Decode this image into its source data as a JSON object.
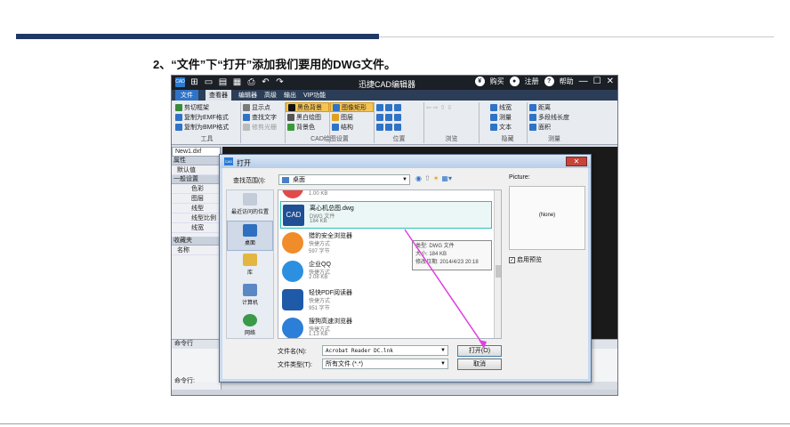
{
  "slide": {
    "heading": "2、“文件”下“打开”添加我们要用的DWG文件。"
  },
  "app": {
    "title": "迅捷CAD编辑器",
    "logo_text": "CAD",
    "top_right": {
      "buy": "购买",
      "register": "注册",
      "help": "帮助"
    },
    "window_controls": {
      "minimize": "—",
      "maximize": "☐",
      "close": "✕"
    },
    "menu_tabs": [
      "文件",
      "查看器",
      "编辑器",
      "高级",
      "输出",
      "VIP功能"
    ],
    "ribbon": {
      "groups": [
        {
          "label": "工具",
          "buttons": [
            "剪切框架",
            "复制为EMF格式",
            "复制为BMP格式"
          ]
        },
        {
          "label": "",
          "buttons": [
            "显示点",
            "查找文字",
            "修剪光栅"
          ]
        },
        {
          "label": "CAD绘图设置",
          "buttons": [
            "黑色背景",
            "黑白绘图",
            "背景色"
          ]
        },
        {
          "label": "",
          "buttons": [
            "图像矩形",
            "图层",
            "结构"
          ]
        },
        {
          "label": "位置",
          "buttons": []
        },
        {
          "label": "浏览",
          "buttons": []
        },
        {
          "label": "隐藏",
          "buttons": [
            "线宽",
            "测量",
            "文本"
          ]
        },
        {
          "label": "测量",
          "buttons": [
            "距离",
            "多段线长度",
            "面积"
          ]
        }
      ]
    },
    "left_panel": {
      "doc_tab": "New1.dxf",
      "props_header": "属性",
      "default_row": "默认值",
      "general_header": "一般设置",
      "rows": [
        "色彩",
        "图层",
        "线型",
        "线型比例",
        "线宽"
      ],
      "favorites_header": "收藏夹",
      "name_row": "名称"
    },
    "command": {
      "header": "命令行",
      "prompt": "命令行:"
    }
  },
  "dialog": {
    "title": "打开",
    "lookin_label": "查找范围(I):",
    "lookin_value": "桌面",
    "places": [
      "最近访问的位置",
      "桌面",
      "库",
      "计算机",
      "网络"
    ],
    "files": [
      {
        "name": "",
        "type": "",
        "size": "1.00 KB"
      },
      {
        "name": "离心机总图.dwg",
        "type": "DWG 文件",
        "size": "184 KB"
      },
      {
        "name": "猎豹安全浏览器",
        "type": "快捷方式",
        "size": "597 字节"
      },
      {
        "name": "企业QQ",
        "type": "快捷方式",
        "size": "2.08 KB"
      },
      {
        "name": "轻快PDF阅读器",
        "type": "快捷方式",
        "size": "951 字节"
      },
      {
        "name": "搜狗高速浏览器",
        "type": "快捷方式",
        "size": "1.13 KB"
      }
    ],
    "tooltip": {
      "type": "类型: DWG 文件",
      "size": "大小: 184 KB",
      "modified": "修改日期: 2014/4/23 20:18"
    },
    "preview_label": "Picture:",
    "preview_none": "(None)",
    "preview_checkbox": "启用预览",
    "filename_label": "文件名(N):",
    "filename_value": "Acrobat Reader DC.lnk",
    "filetype_label": "文件类型(T):",
    "filetype_value": "所有文件 (*.*)",
    "open_button": "打开(O)",
    "cancel_button": "取消"
  },
  "colors": {
    "slide_bar": "#1f3864",
    "highlight_box": "#2dbfb5",
    "arrow": "#e040e0"
  }
}
